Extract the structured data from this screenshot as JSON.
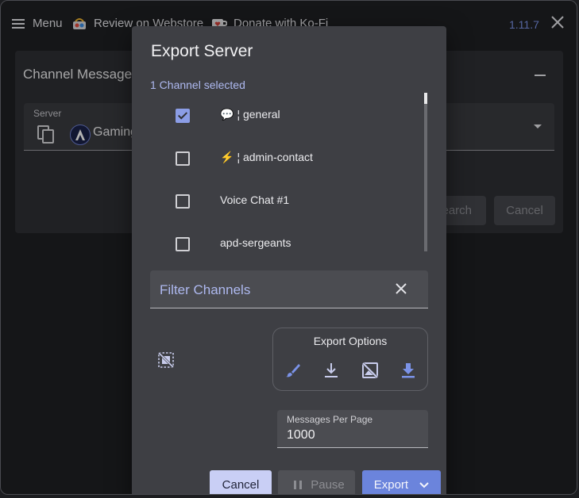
{
  "topbar": {
    "menu_label": "Menu",
    "webstore_label": "Review on Webstore",
    "kofi_label": "Donate with Ko-Fi",
    "version": "1.11.7"
  },
  "background": {
    "title": "Channel Messages",
    "server_field_label": "Server",
    "server_value": "Gaming-",
    "search_button": "Search",
    "cancel_button": "Cancel"
  },
  "dialog": {
    "title": "Export Server",
    "selection_status": "1 Channel selected",
    "channels": [
      {
        "emoji": "💬",
        "label": "¦ general",
        "checked": true
      },
      {
        "emoji": "⚡",
        "label": "¦ admin-contact",
        "checked": false
      },
      {
        "emoji": "",
        "label": "Voice Chat #1",
        "checked": false
      },
      {
        "emoji": "",
        "label": "apd-sergeants",
        "checked": false
      }
    ],
    "filter_placeholder": "Filter Channels",
    "export_options_title": "Export Options",
    "export_option_icons": [
      "brush-icon",
      "download-icon",
      "hide-image-icon",
      "download-all-icon"
    ],
    "messages_per_page_label": "Messages Per Page",
    "messages_per_page_value": "1000",
    "cancel_button": "Cancel",
    "pause_button": "Pause",
    "export_button": "Export"
  },
  "colors": {
    "accent": "#6b84dc",
    "accent_light": "#aeb9f0",
    "dialog_bg": "#3e3f44",
    "version": "#7b93e8"
  }
}
